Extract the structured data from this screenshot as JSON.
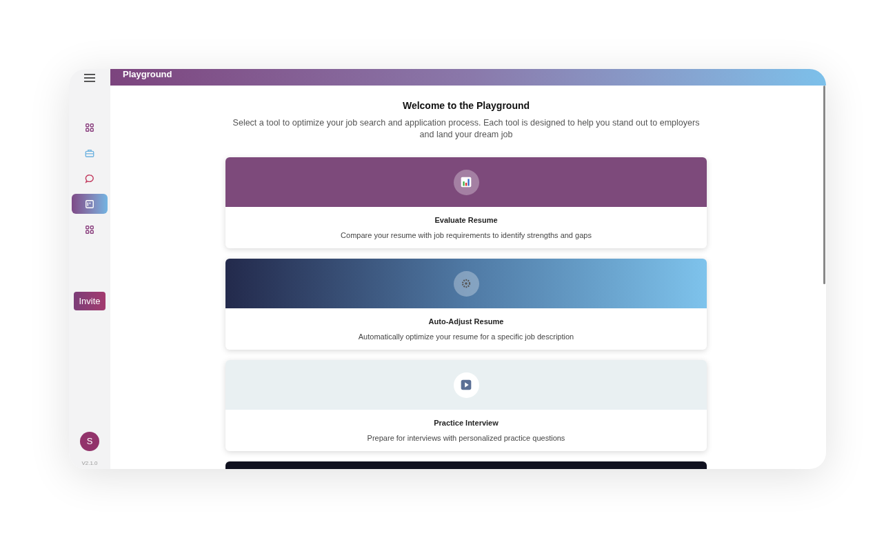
{
  "header": {
    "title": "Playground"
  },
  "sidebar": {
    "items": [
      {
        "kind": "grid",
        "selected": false
      },
      {
        "kind": "briefcase",
        "selected": false
      },
      {
        "kind": "chat",
        "selected": false
      },
      {
        "kind": "board",
        "selected": true
      },
      {
        "kind": "grid",
        "selected": false
      }
    ],
    "invite": "Invite",
    "avatar": "S",
    "version": "V2.1.0"
  },
  "intro": {
    "title": "Welcome to the Playground",
    "text": "Select a tool to optimize your job search and application process. Each tool is designed to help you stand out to employers and land your dream job"
  },
  "tools": [
    {
      "kind": "chart",
      "title": "Evaluate Resume",
      "description": "Compare your resume with job requirements to identify strengths and gaps"
    },
    {
      "kind": "gear",
      "title": "Auto-Adjust Resume",
      "description": "Automatically optimize your resume for a specific job description"
    },
    {
      "kind": "play",
      "title": "Practice Interview",
      "description": "Prepare for interviews with personalized practice questions"
    },
    {
      "kind": "dark"
    }
  ]
}
